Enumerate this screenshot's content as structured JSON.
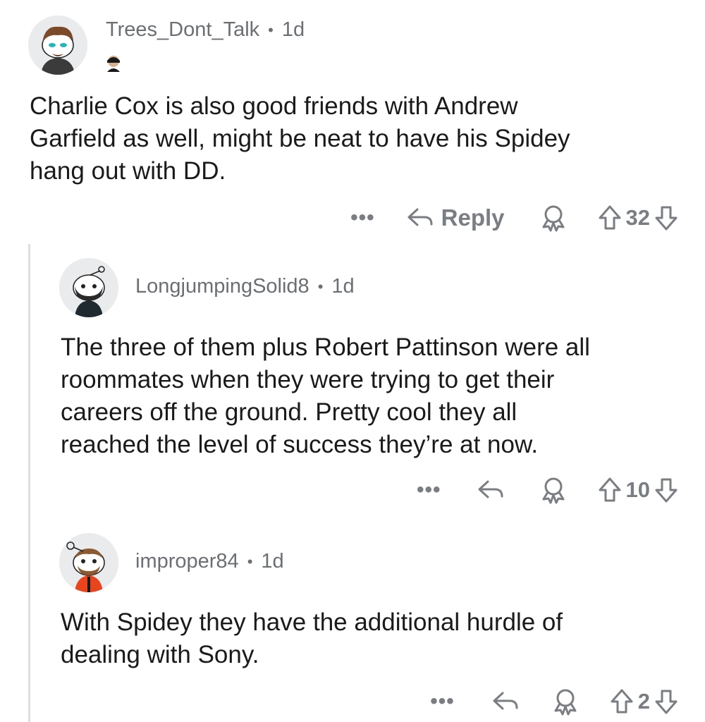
{
  "comments": [
    {
      "author": "Trees_Dont_Talk",
      "age": "1d",
      "text_lines": [
        "Charlie Cox is also good friends with Andrew",
        "Garfield as well, might be neat to have his Spidey",
        "hang out with DD."
      ],
      "more": "•••",
      "reply_label": "Reply",
      "score": "32",
      "avatar_icon": "snoo-avatar-icon",
      "flair_icon": "mask-flair-icon"
    },
    {
      "author": "LongjumpingSolid8",
      "age": "1d",
      "text_lines": [
        "The three of them plus Robert Pattinson were all",
        "roommates when they were trying to get their",
        "careers off the ground. Pretty cool they all",
        "reached the level of success they’re at now."
      ],
      "more": "•••",
      "score": "10",
      "avatar_icon": "snoo-avatar-icon"
    },
    {
      "author": "improper84",
      "age": "1d",
      "text_lines": [
        "With Spidey they have the additional hurdle of",
        "dealing with Sony."
      ],
      "more": "•••",
      "score": "2",
      "avatar_icon": "snoo-avatar-icon"
    }
  ],
  "separator": "•",
  "colors": {
    "meta": "#6b6f73",
    "action": "#7a7e82",
    "thread_line": "#dcdfe2"
  }
}
